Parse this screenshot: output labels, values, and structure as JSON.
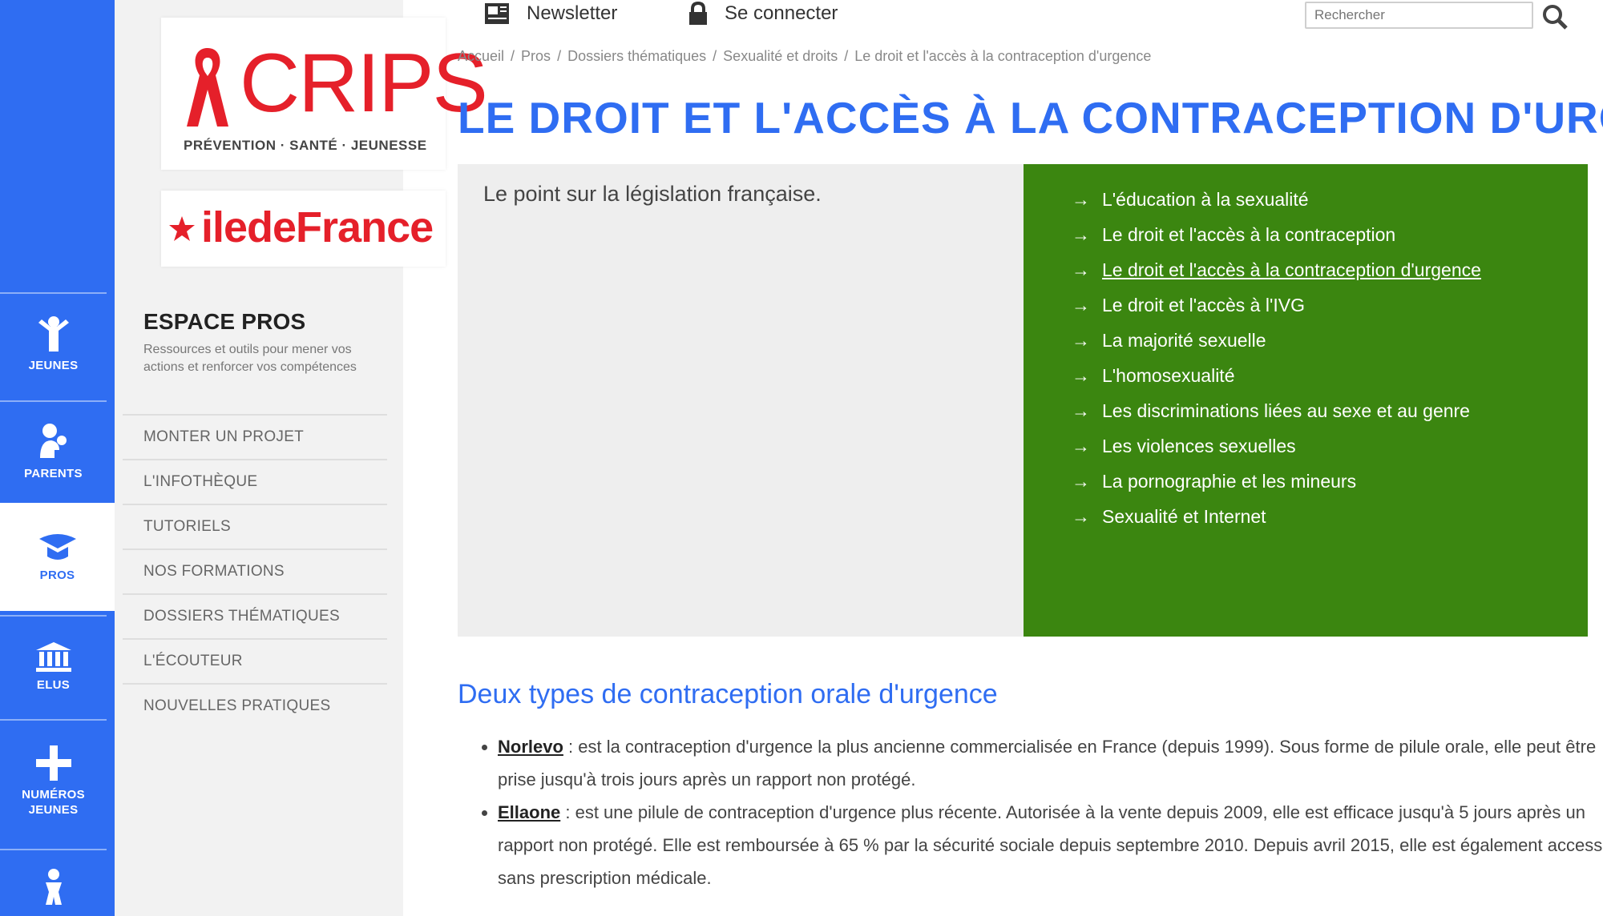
{
  "rail": {
    "items": [
      {
        "label": "JEUNES",
        "icon": "person-icon"
      },
      {
        "label": "PARENTS",
        "icon": "parents-icon"
      },
      {
        "label": "PROS",
        "icon": "pros-icon"
      },
      {
        "label": "ELUS",
        "icon": "institution-icon"
      },
      {
        "label": "NUMÉROS JEUNES",
        "icon": "plus-icon"
      },
      {
        "label": "",
        "icon": "figure-icon"
      }
    ],
    "active": "PROS",
    "colors": {
      "rail": "#2f6df2",
      "active_bg": "#ffffff"
    }
  },
  "logos": {
    "crips": {
      "word": "CRIPS",
      "tagline": "PRÉVENTION · SANTÉ · JEUNESSE"
    },
    "idf": {
      "word": "iledeFrance"
    }
  },
  "pros_menu": {
    "title": "ESPACE PROS",
    "description": "Ressources et outils pour mener vos actions et renforcer vos compétences",
    "items": [
      "MONTER UN PROJET",
      "L'INFOTHÈQUE",
      "TUTORIELS",
      "NOS FORMATIONS",
      "DOSSIERS THÉMATIQUES",
      "L'ÉCOUTEUR",
      "NOUVELLES PRATIQUES"
    ]
  },
  "topbar": {
    "newsletter": "Newsletter",
    "connect": "Se connecter",
    "search_placeholder": "Rechercher"
  },
  "breadcrumb": [
    "Accueil",
    "Pros",
    "Dossiers thématiques",
    "Sexualité et droits",
    "Le droit et l'accès à la contraception d'urgence"
  ],
  "page": {
    "title": "LE DROIT ET L'ACCÈS À LA CONTRACEPTION D'URGENCE",
    "intro": "Le point sur la législation française.",
    "topics": [
      "L'éducation à la sexualité",
      "Le droit et l'accès à la contraception",
      "Le droit et l'accès à la contraception d'urgence",
      "Le droit et l'accès à l'IVG",
      "La majorité sexuelle",
      "L'homosexualité",
      "Les discriminations liées au sexe et au genre",
      "Les violences sexuelles",
      "La pornographie et les mineurs",
      "Sexualité et Internet"
    ],
    "current_topic_index": 2,
    "section_heading": "Deux types de contraception orale d'urgence",
    "pills": [
      {
        "name": "Norlevo",
        "text": " : est la contraception d'urgence la plus ancienne commercialisée en France (depuis 1999). Sous forme de pilule orale, elle peut être prise jusqu'à trois jours après un rapport non protégé."
      },
      {
        "name": "Ellaone",
        "text": " : est une pilule de contraception d'urgence plus récente. Autorisée à la vente depuis 2009, elle est efficace jusqu'à 5 jours après un rapport non protégé. Elle est remboursée à 65 % par la sécurité sociale depuis septembre 2010. Depuis avril 2015, elle est également accessible sans prescription médicale."
      }
    ],
    "colors": {
      "title": "#2f6df2",
      "topics_bg": "#3b8610",
      "intro_bg": "#eeeeee"
    }
  }
}
